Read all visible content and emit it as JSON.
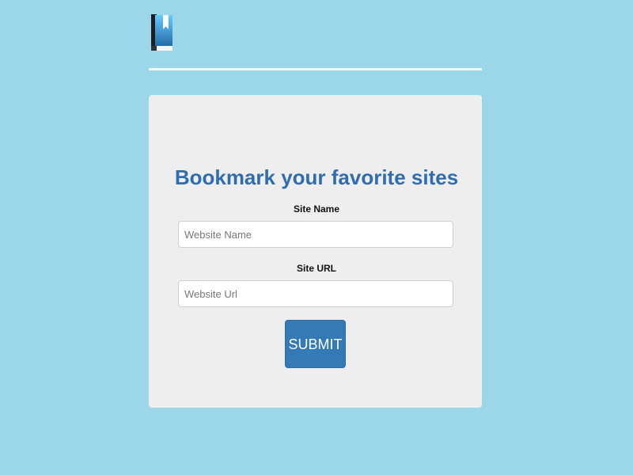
{
  "header": {
    "logo_icon": "bookmark-book-icon"
  },
  "form": {
    "title": "Bookmark your favorite sites",
    "site_name_label": "Site Name",
    "site_name_placeholder": "Website Name",
    "site_name_value": "",
    "site_url_label": "Site URL",
    "site_url_placeholder": "Website Url",
    "site_url_value": "",
    "submit_label": "SUBMIT"
  },
  "colors": {
    "background": "#9bd7e9",
    "card": "#eeeeee",
    "title": "#2f6db0",
    "button": "#337ab7"
  }
}
